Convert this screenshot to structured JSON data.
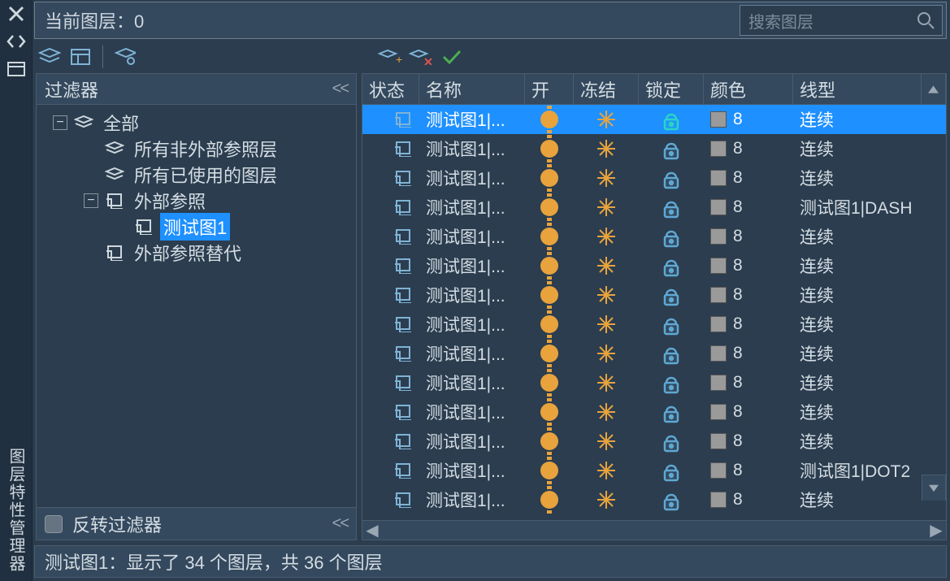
{
  "header": {
    "current_layer_label": "当前图层：0",
    "search_placeholder": "搜索图层"
  },
  "filters": {
    "title": "过滤器",
    "invert_label": "反转过滤器",
    "tree": {
      "root": {
        "label": "全部"
      },
      "children": [
        {
          "label": "所有非外部参照层"
        },
        {
          "label": "所有已使用的图层"
        },
        {
          "label": "外部参照",
          "children": [
            {
              "label": "测试图1",
              "selected": true
            }
          ]
        },
        {
          "label": "外部参照替代"
        }
      ]
    }
  },
  "columns": {
    "status": "状态",
    "name": "名称",
    "on": "开",
    "freeze": "冻结",
    "lock": "锁定",
    "color": "颜色",
    "linetype": "线型"
  },
  "rows": [
    {
      "name": "测试图1|...",
      "color": "8",
      "linetype": "连续",
      "selected": true
    },
    {
      "name": "测试图1|...",
      "color": "8",
      "linetype": "连续"
    },
    {
      "name": "测试图1|...",
      "color": "8",
      "linetype": "连续"
    },
    {
      "name": "测试图1|...",
      "color": "8",
      "linetype": "测试图1|DASH"
    },
    {
      "name": "测试图1|...",
      "color": "8",
      "linetype": "连续"
    },
    {
      "name": "测试图1|...",
      "color": "8",
      "linetype": "连续"
    },
    {
      "name": "测试图1|...",
      "color": "8",
      "linetype": "连续"
    },
    {
      "name": "测试图1|...",
      "color": "8",
      "linetype": "连续"
    },
    {
      "name": "测试图1|...",
      "color": "8",
      "linetype": "连续"
    },
    {
      "name": "测试图1|...",
      "color": "8",
      "linetype": "连续"
    },
    {
      "name": "测试图1|...",
      "color": "8",
      "linetype": "连续"
    },
    {
      "name": "测试图1|...",
      "color": "8",
      "linetype": "连续"
    },
    {
      "name": "测试图1|...",
      "color": "8",
      "linetype": "测试图1|DOT2"
    },
    {
      "name": "测试图1|...",
      "color": "8",
      "linetype": "连续"
    }
  ],
  "status_bar": "测试图1：显示了 34 个图层，共 36 个图层",
  "panel_title": "图层特性管理器"
}
